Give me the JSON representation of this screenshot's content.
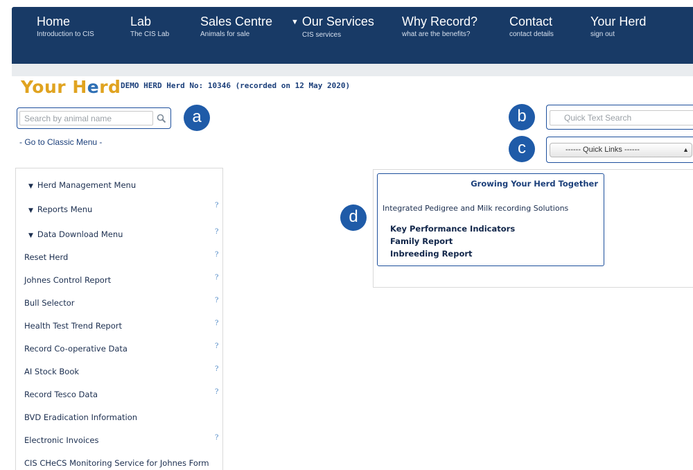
{
  "nav": [
    {
      "title": "Home",
      "subtitle": "Introduction to CIS"
    },
    {
      "title": "Lab",
      "subtitle": "The CIS Lab"
    },
    {
      "title": "Sales Centre",
      "subtitle": "Animals for sale"
    },
    {
      "title": "Our Services",
      "subtitle": "CIS services"
    },
    {
      "title": "Why Record?",
      "subtitle": "what are the benefits?"
    },
    {
      "title": "Contact",
      "subtitle": "contact details"
    },
    {
      "title": "Your Herd",
      "subtitle": "sign out"
    }
  ],
  "header": {
    "logo_part1": "Your H",
    "logo_part2": "e",
    "logo_part3": "rd",
    "herd_info": "DEMO HERD Herd No: 10346 (recorded on 12 May 2020)"
  },
  "search": {
    "placeholder": "Search by animal name"
  },
  "classic_menu_link": "- Go to Classic Menu -",
  "callouts": {
    "a": "a",
    "b": "b",
    "c": "c",
    "d": "d"
  },
  "quick_text_search": {
    "placeholder": "Quick Text Search"
  },
  "quick_links": {
    "selected": "------ Quick Links ------"
  },
  "sidebar": {
    "help_symbol": "?",
    "expandable": [
      {
        "label": "Herd Management Menu"
      },
      {
        "label": "Reports Menu"
      },
      {
        "label": "Data Download Menu"
      }
    ],
    "items": [
      {
        "label": "Reset Herd"
      },
      {
        "label": "Johnes Control Report"
      },
      {
        "label": "Bull Selector"
      },
      {
        "label": "Health Test Trend Report"
      },
      {
        "label": "Record Co-operative Data"
      },
      {
        "label": "AI Stock Book"
      },
      {
        "label": "Record Tesco Data"
      },
      {
        "label": "BVD Eradication Information"
      },
      {
        "label": "Electronic Invoices"
      },
      {
        "label": "CIS CHeCS Monitoring Service for Johnes Form"
      }
    ]
  },
  "panel": {
    "title": "Growing Your Herd Together",
    "subtitle": "Integrated Pedigree and Milk recording Solutions",
    "links": [
      {
        "label": "Key Performance Indicators"
      },
      {
        "label": "Family Report"
      },
      {
        "label": "Inbreeding Report"
      }
    ]
  }
}
